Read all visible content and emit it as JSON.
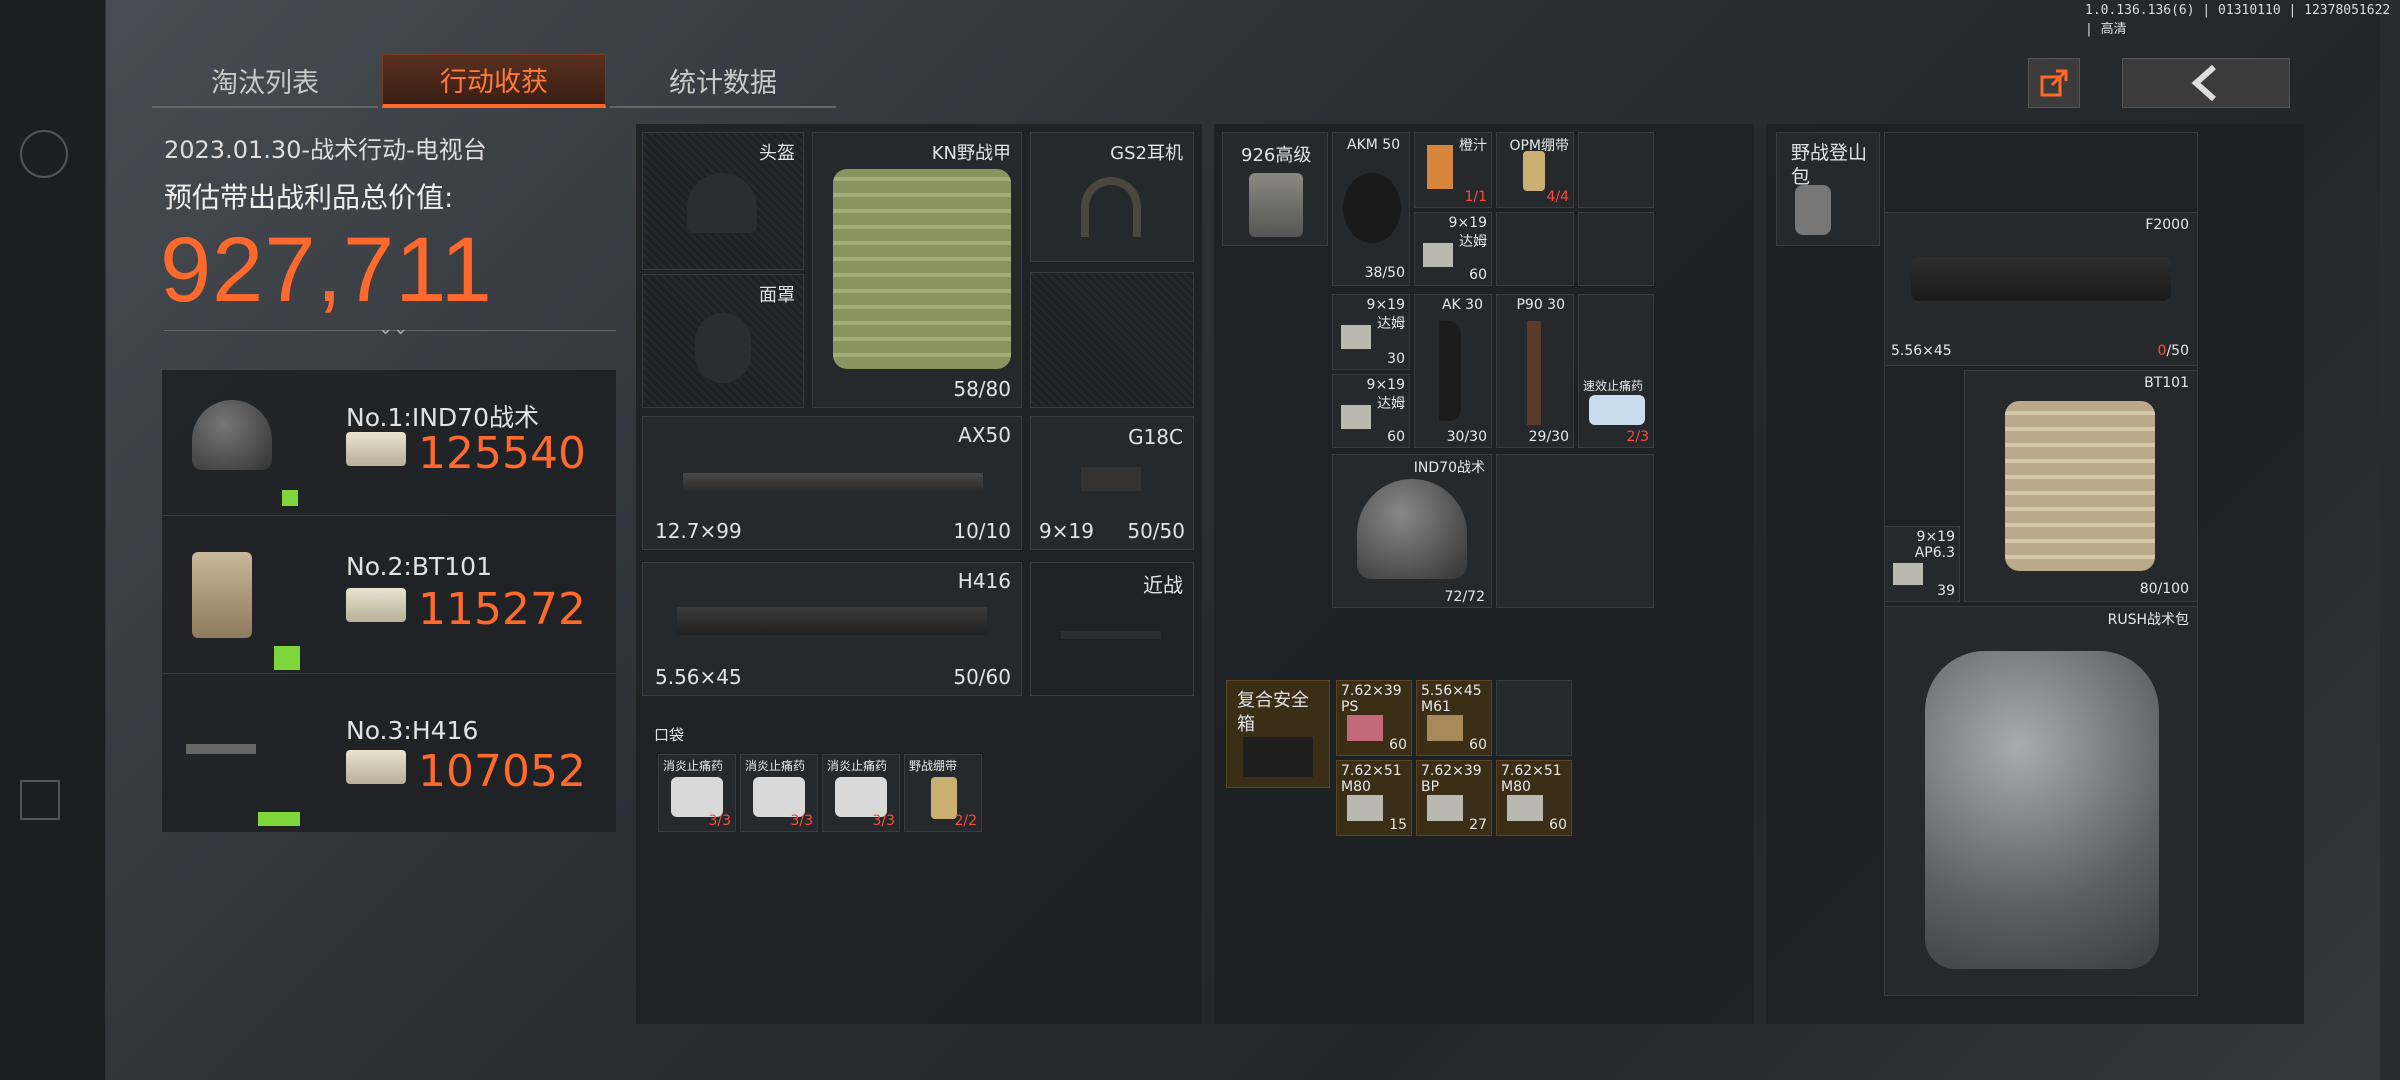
{
  "version_text": "1.0.136.136(6) | 01310110 | 12378051622 | 高清",
  "tabs": [
    {
      "label": "淘汰列表",
      "active": false
    },
    {
      "label": "行动收获",
      "active": true
    },
    {
      "label": "统计数据",
      "active": false
    }
  ],
  "summary": {
    "date_line": "2023.01.30-战术行动-电视台",
    "estimate_label": "预估带出战利品总价值:",
    "total_value": "927,711",
    "expand_glyph": "⌄⌄"
  },
  "top_items": [
    {
      "rank_label": "No.1:IND70战术",
      "value": "125540",
      "icon": "helmet-icon"
    },
    {
      "rank_label": "No.2:BT101",
      "value": "115272",
      "icon": "vest-icon"
    },
    {
      "rank_label": "No.3:H416",
      "value": "107052",
      "icon": "rifle-icon"
    }
  ],
  "equipment": {
    "helmet_label": "头盔",
    "mask_label": "面罩",
    "armor": {
      "name": "KN野战甲",
      "durability": "58/80"
    },
    "headset": {
      "name": "GS2耳机"
    },
    "primary": {
      "name": "AX50",
      "caliber": "12.7×99",
      "ammo": "10/10"
    },
    "pistol": {
      "name": "G18C",
      "caliber": "9×19",
      "ammo": "50/50"
    },
    "secondary": {
      "name": "H416",
      "caliber": "5.56×45",
      "ammo": "50/60"
    },
    "melee_label": "近战",
    "pocket_label": "口袋",
    "pocket_items": [
      {
        "name": "消炎止痛药",
        "count": "3/3"
      },
      {
        "name": "消炎止痛药",
        "count": "3/3"
      },
      {
        "name": "消炎止痛药",
        "count": "3/3"
      },
      {
        "name": "野战绷带",
        "count": "2/2"
      }
    ]
  },
  "rig": {
    "title": "926高级",
    "cells": [
      {
        "name": "AKM 50",
        "count": "38/50"
      },
      {
        "name": "橙汁",
        "count": "1/1"
      },
      {
        "name": "OPM绷带",
        "count": "4/4"
      },
      {
        "name": "9×19 达姆",
        "count": "60"
      },
      {
        "name": "9×19 达姆",
        "count": "30"
      },
      {
        "name": "AK 30",
        "count": "30/30"
      },
      {
        "name": "P90 30",
        "count": "29/30"
      },
      {
        "name": "速效止痛药",
        "count": "2/3"
      },
      {
        "name": "9×19 达姆",
        "count": "60"
      },
      {
        "name": "IND70战术",
        "count": "72/72"
      }
    ]
  },
  "safe_box": {
    "title": "复合安全箱",
    "cells": [
      {
        "name": "7.62×39 PS",
        "count": "60"
      },
      {
        "name": "5.56×45 M61",
        "count": "60"
      },
      {
        "name": "7.62×51 M80",
        "count": "15"
      },
      {
        "name": "7.62×39 BP",
        "count": "27"
      },
      {
        "name": "7.62×51 M80",
        "count": "60"
      }
    ]
  },
  "backpack": {
    "title": "野战登山包",
    "f2000": {
      "name": "F2000",
      "caliber": "5.56×45",
      "ammo_red": "0",
      "ammo_max": "/50"
    },
    "bt101": {
      "name": "BT101",
      "durability": "80/100"
    },
    "ammo_cell": {
      "name": "9×19 AP6.3",
      "count": "39"
    },
    "rush": {
      "name": "RUSH战术包"
    }
  },
  "colors": {
    "accent": "#ff6a2c",
    "count_red": "#ff4a3c",
    "grid_green": "#7dd63a"
  }
}
